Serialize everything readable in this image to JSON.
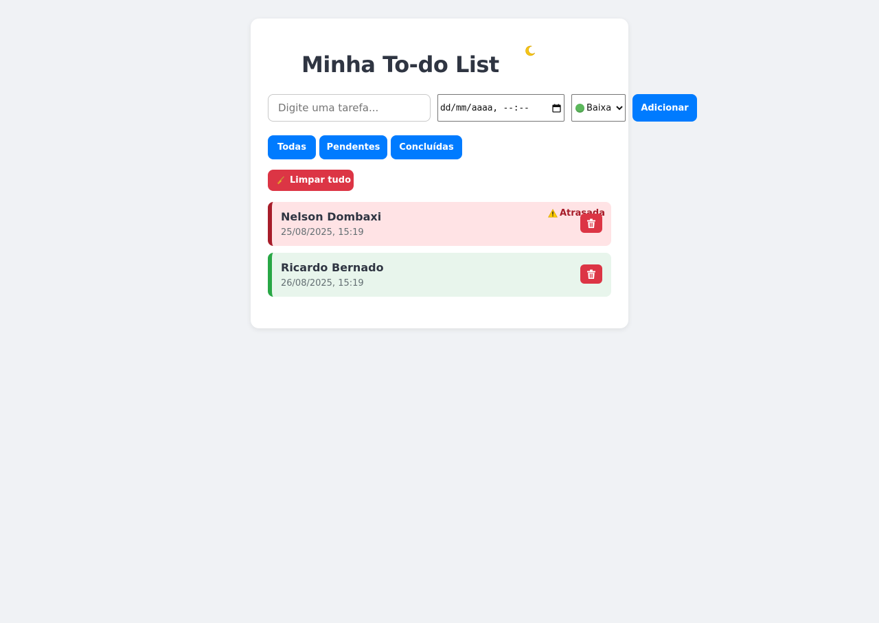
{
  "app": {
    "title": "Minha To-do List",
    "theme_toggle_icon": "moon-icon"
  },
  "form": {
    "task_placeholder": "Digite uma tarefa...",
    "task_value": "",
    "date_placeholder": "dd/mm/aaaa, --:--",
    "priority_selected": "Baixa",
    "priority_icon": "green-circle-icon",
    "add_label": "Adicionar"
  },
  "filters": [
    {
      "label": "Todas"
    },
    {
      "label": "Pendentes"
    },
    {
      "label": "Concluídas"
    }
  ],
  "clear_button": {
    "label": "Limpar tudo",
    "icon": "broom-icon"
  },
  "tasks": [
    {
      "name": "Nelson Dombaxi",
      "due": "25/08/2025, 15:19",
      "status": "overdue",
      "badge": "Atrasada",
      "badge_icon": "warning-icon"
    },
    {
      "name": "Ricardo Bernado",
      "due": "26/08/2025, 15:19",
      "status": "ok"
    }
  ],
  "colors": {
    "primary": "#007bff",
    "danger": "#dc3545",
    "overdue_border": "#a71d2a",
    "overdue_bg": "#ffe3e5",
    "ok_border": "#28a745",
    "ok_bg": "#e8f5ec",
    "page_bg": "#f0f2f5"
  }
}
